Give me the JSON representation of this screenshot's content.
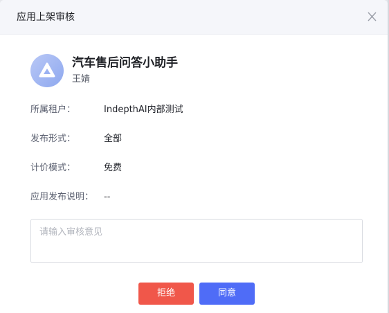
{
  "dialog": {
    "title": "应用上架审核",
    "close_label": "X"
  },
  "app": {
    "name": "汽车售后问答小助手",
    "author": "王婧",
    "logo_icon": "triangle-app-logo-icon"
  },
  "info": [
    {
      "label": "所属租户：",
      "value": "IndepthAI内部测试"
    },
    {
      "label": "发布形式：",
      "value": "全部"
    },
    {
      "label": "计价模式：",
      "value": "免费"
    },
    {
      "label": "应用发布说明：",
      "value": "--"
    }
  ],
  "review": {
    "placeholder": "请输入审核意见",
    "value": ""
  },
  "actions": {
    "reject_label": "拒绝",
    "approve_label": "同意"
  },
  "colors": {
    "reject": "#f0574a",
    "approve": "#4f6cf7",
    "header_bg": "#f5f6fa"
  }
}
